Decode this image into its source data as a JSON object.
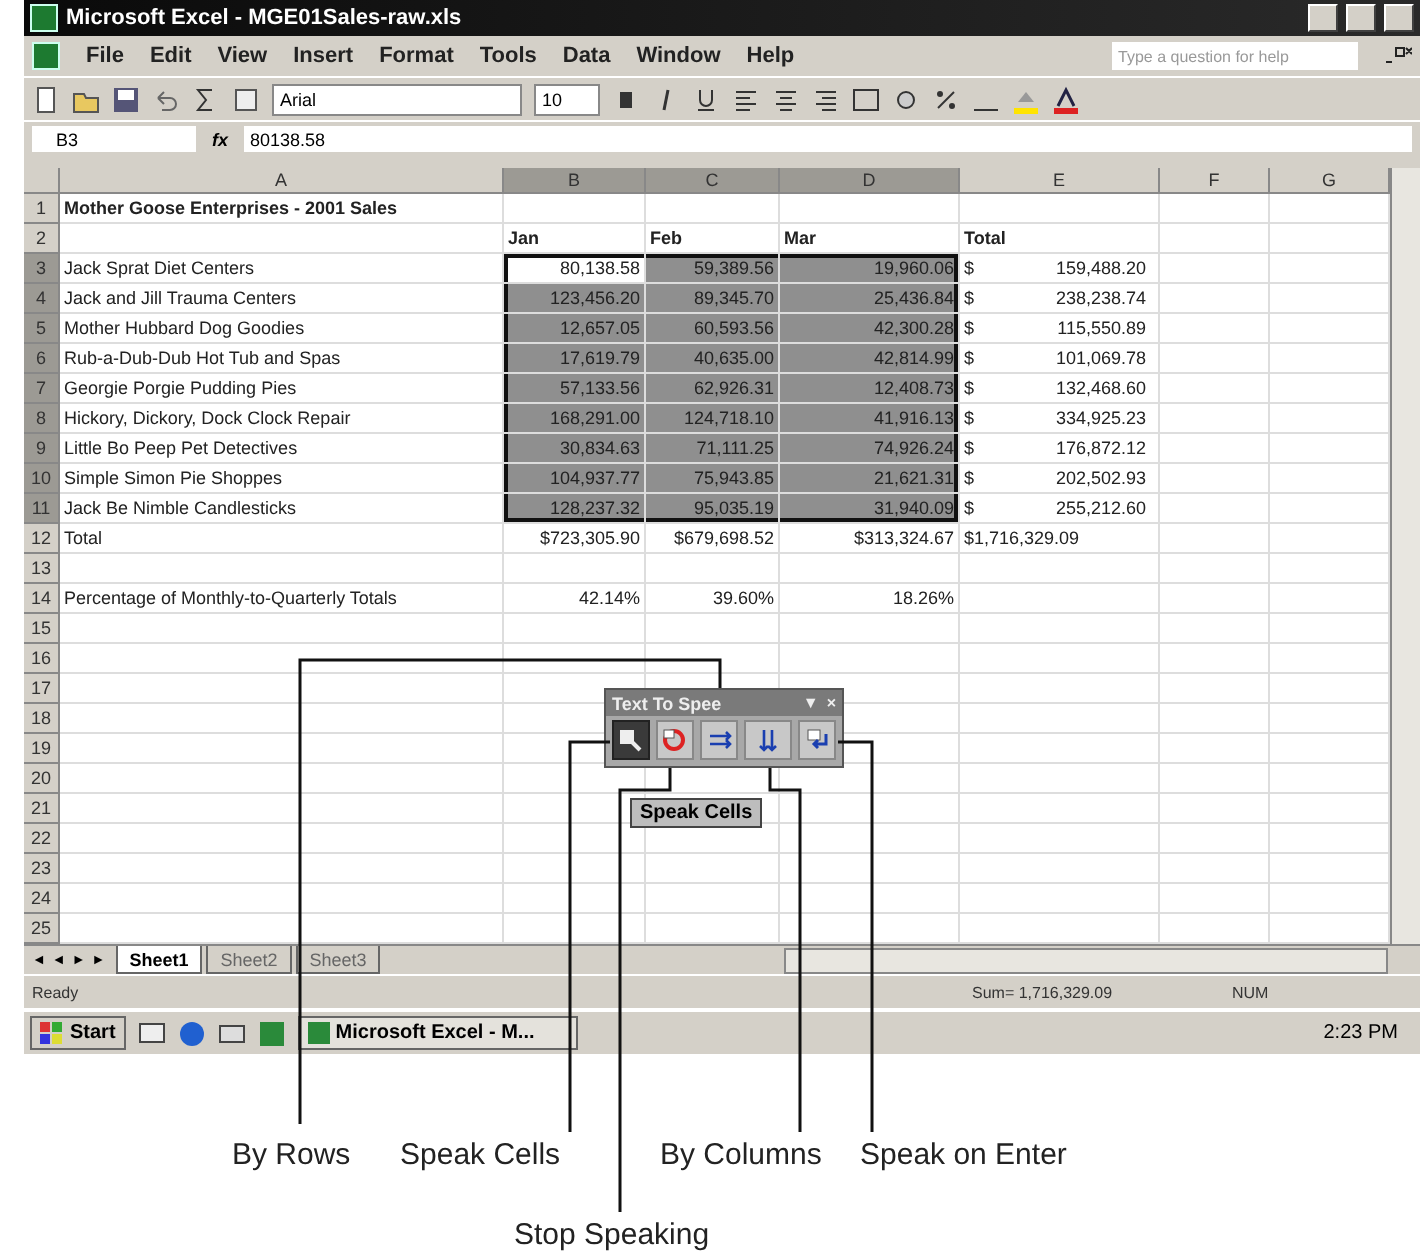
{
  "window": {
    "title": "Microsoft Excel - MGE01Sales-raw.xls"
  },
  "menu": [
    "File",
    "Edit",
    "View",
    "Insert",
    "Format",
    "Tools",
    "Data",
    "Window",
    "Help"
  ],
  "help_box": {
    "placeholder": "Type a question for help"
  },
  "toolbar": {
    "font": "Arial",
    "size": "10"
  },
  "formula_bar": {
    "name_box": "B3",
    "fx": "fx",
    "value": "80138.58"
  },
  "columns": [
    {
      "label": "A",
      "selected": false
    },
    {
      "label": "B",
      "selected": true
    },
    {
      "label": "C",
      "selected": true
    },
    {
      "label": "D",
      "selected": true
    },
    {
      "label": "E",
      "selected": false
    },
    {
      "label": "F",
      "selected": false
    },
    {
      "label": "G",
      "selected": false
    }
  ],
  "rows": [
    {
      "num": "1",
      "kind": "title",
      "selected": false,
      "a": "Mother Goose Enterprises - 2001 Sales"
    },
    {
      "num": "2",
      "kind": "header",
      "selected": false,
      "b": "Jan",
      "c": "Feb",
      "d": "Mar",
      "e": "Total"
    },
    {
      "num": "3",
      "kind": "data",
      "selected": true,
      "active": true,
      "a": "Jack Sprat Diet Centers",
      "b": "80,138.58",
      "c": "59,389.56",
      "d": "19,960.06",
      "e_sign": "$",
      "e": "159,488.20"
    },
    {
      "num": "4",
      "kind": "data",
      "selected": true,
      "active": false,
      "a": "Jack and Jill Trauma Centers",
      "b": "123,456.20",
      "c": "89,345.70",
      "d": "25,436.84",
      "e_sign": "$",
      "e": "238,238.74"
    },
    {
      "num": "5",
      "kind": "data",
      "selected": true,
      "active": false,
      "a": "Mother Hubbard Dog Goodies",
      "b": "12,657.05",
      "c": "60,593.56",
      "d": "42,300.28",
      "e_sign": "$",
      "e": "115,550.89"
    },
    {
      "num": "6",
      "kind": "data",
      "selected": true,
      "active": false,
      "a": "Rub-a-Dub-Dub Hot Tub and Spas",
      "b": "17,619.79",
      "c": "40,635.00",
      "d": "42,814.99",
      "e_sign": "$",
      "e": "101,069.78"
    },
    {
      "num": "7",
      "kind": "data",
      "selected": true,
      "active": false,
      "a": "Georgie Porgie Pudding Pies",
      "b": "57,133.56",
      "c": "62,926.31",
      "d": "12,408.73",
      "e_sign": "$",
      "e": "132,468.60"
    },
    {
      "num": "8",
      "kind": "data",
      "selected": true,
      "active": false,
      "a": "Hickory, Dickory, Dock Clock Repair",
      "b": "168,291.00",
      "c": "124,718.10",
      "d": "41,916.13",
      "e_sign": "$",
      "e": "334,925.23"
    },
    {
      "num": "9",
      "kind": "data",
      "selected": true,
      "active": false,
      "a": "Little Bo Peep Pet Detectives",
      "b": "30,834.63",
      "c": "71,111.25",
      "d": "74,926.24",
      "e_sign": "$",
      "e": "176,872.12"
    },
    {
      "num": "10",
      "kind": "data",
      "selected": true,
      "active": false,
      "a": "Simple Simon Pie Shoppes",
      "b": "104,937.77",
      "c": "75,943.85",
      "d": "21,621.31",
      "e_sign": "$",
      "e": "202,502.93"
    },
    {
      "num": "11",
      "kind": "data",
      "selected": true,
      "active": false,
      "a": "Jack Be Nimble Candlesticks",
      "b": "128,237.32",
      "c": "95,035.19",
      "d": "31,940.09",
      "e_sign": "$",
      "e": "255,212.60"
    },
    {
      "num": "12",
      "kind": "data",
      "selected": false,
      "a": "Total",
      "b": "$723,305.90",
      "c": "$679,698.52",
      "d": "$313,324.67",
      "e": "$1,716,329.09"
    },
    {
      "num": "13",
      "kind": "data",
      "selected": false
    },
    {
      "num": "14",
      "kind": "data",
      "selected": false,
      "a": "Percentage of Monthly-to-Quarterly Totals",
      "b": "42.14%",
      "c": "39.60%",
      "d": "18.26%"
    },
    {
      "num": "15",
      "kind": "data",
      "selected": false
    },
    {
      "num": "16",
      "kind": "data",
      "selected": false
    },
    {
      "num": "17",
      "kind": "data",
      "selected": false
    },
    {
      "num": "18",
      "kind": "data",
      "selected": false
    },
    {
      "num": "19",
      "kind": "data",
      "selected": false
    },
    {
      "num": "20",
      "kind": "data",
      "selected": false
    },
    {
      "num": "21",
      "kind": "data",
      "selected": false
    },
    {
      "num": "22",
      "kind": "data",
      "selected": false
    },
    {
      "num": "23",
      "kind": "data",
      "selected": false
    },
    {
      "num": "24",
      "kind": "data",
      "selected": false
    },
    {
      "num": "25",
      "kind": "data",
      "selected": false
    }
  ],
  "speech_toolbar": {
    "title": "Text To Spee",
    "menu_glyph": "▼",
    "close_glyph": "×",
    "buttons": [
      {
        "kind": "speak-cells",
        "hovered": true
      },
      {
        "kind": "stop",
        "hovered": false
      },
      {
        "kind": "by-rows",
        "hovered": false
      },
      {
        "kind": "by-columns",
        "hovered": false
      },
      {
        "kind": "speak-on-enter",
        "hovered": false
      }
    ],
    "tooltip": "Speak Cells"
  },
  "sheet_nav": "◄◄►►",
  "sheet_tabs": [
    {
      "label": "Sheet1",
      "selected": true
    },
    {
      "label": "Sheet2",
      "selected": false
    },
    {
      "label": "Sheet3",
      "selected": false
    }
  ],
  "status_bar": {
    "state": "Ready",
    "sum": "Sum= 1,716,329.09",
    "mode": "NUM"
  },
  "taskbar": {
    "start": "Start",
    "task": "Microsoft Excel - M...",
    "clock": "2:23 PM"
  },
  "callouts": [
    {
      "label": "By Rows"
    },
    {
      "label": "Speak Cells"
    },
    {
      "label": "Stop Speaking"
    },
    {
      "label": "By Columns"
    },
    {
      "label": "Speak on Enter"
    }
  ]
}
